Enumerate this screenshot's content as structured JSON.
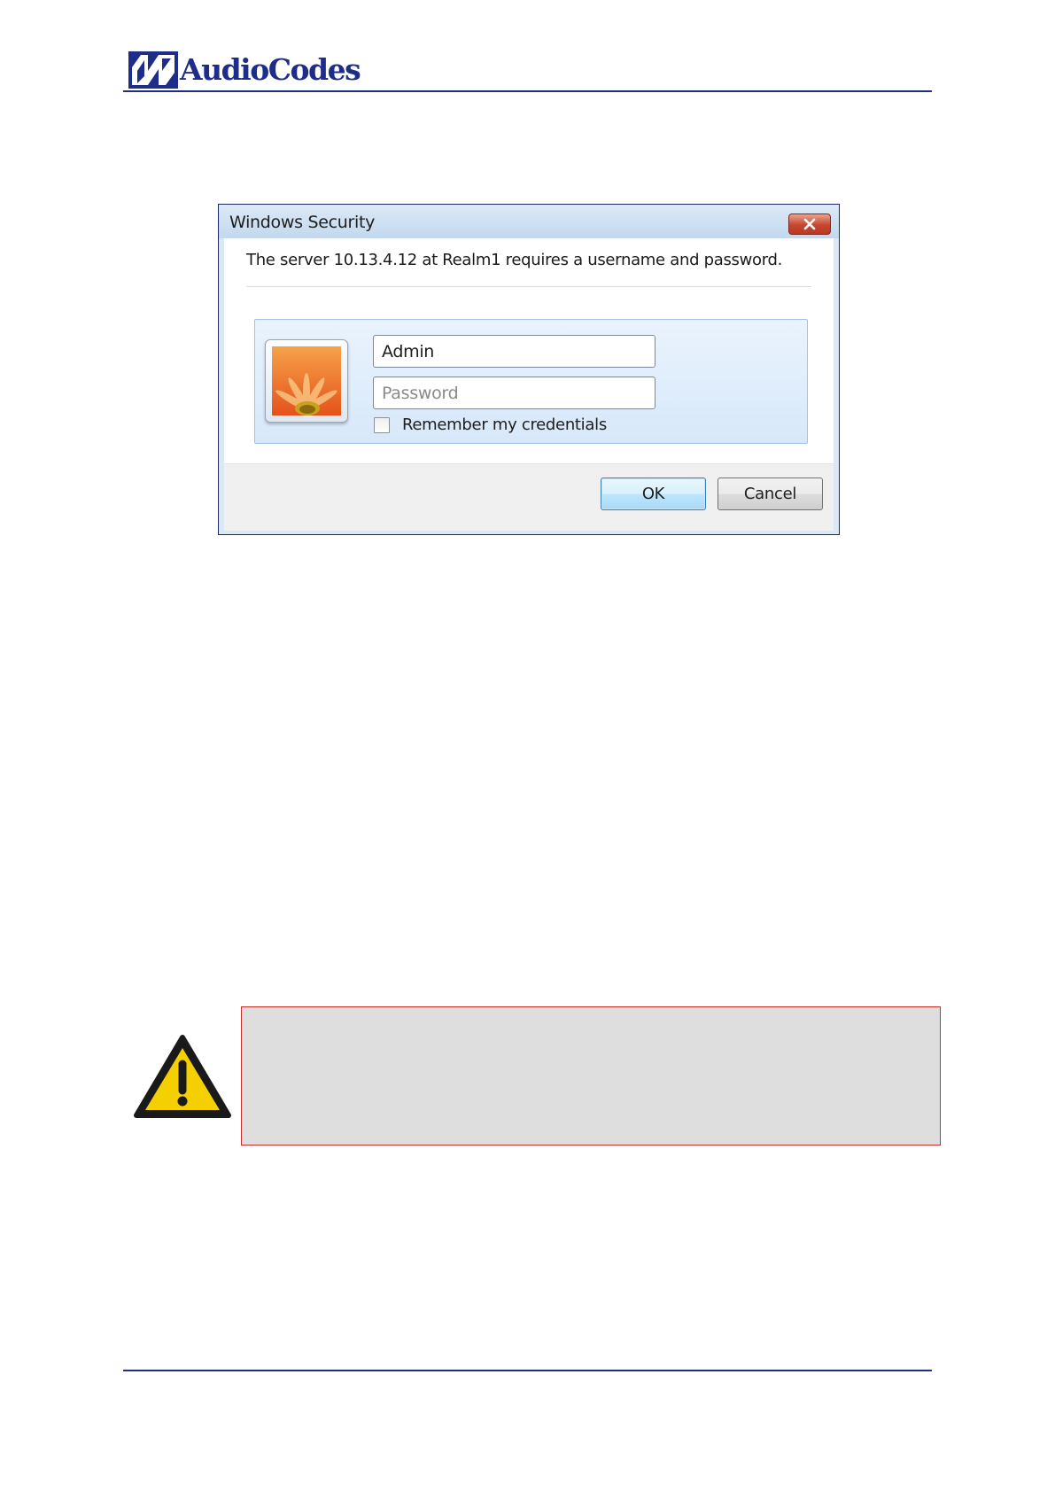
{
  "header": {
    "logo_text": "AudioCodes",
    "brand_color": "#1f2d8a"
  },
  "dialog": {
    "title": "Windows Security",
    "message": "The server 10.13.4.12 at Realm1 requires a username and password.",
    "username": {
      "value": "Admin"
    },
    "password": {
      "value": "",
      "placeholder": "Password"
    },
    "remember": {
      "label": "Remember my credentials",
      "checked": false
    },
    "buttons": {
      "ok": "OK",
      "cancel": "Cancel"
    },
    "icons": {
      "close": "close-icon",
      "user_tile": "flower-user-tile-icon"
    }
  },
  "note": {
    "icon": "warning-icon",
    "border_color": "#c8302c",
    "background": "#dedede"
  }
}
